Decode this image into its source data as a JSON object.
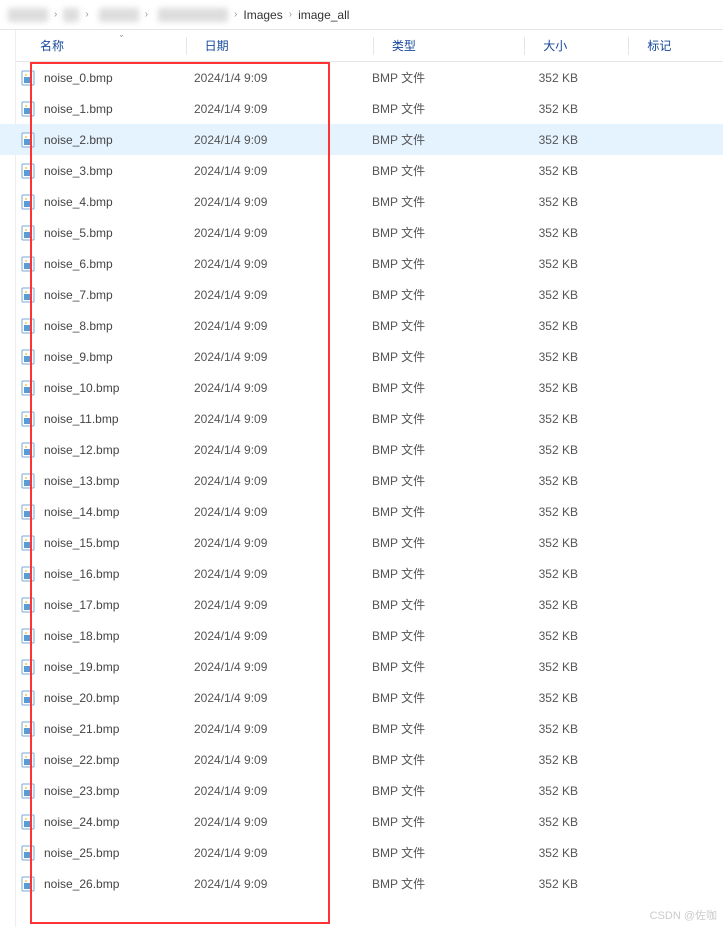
{
  "breadcrumb": {
    "sep": "›",
    "items": [
      "Images",
      "image_all"
    ]
  },
  "headers": {
    "name": "名称",
    "date": "日期",
    "type": "类型",
    "size": "大小",
    "tag": "标记",
    "sort_glyph": "ˇ"
  },
  "file_defaults": {
    "date": "2024/1/4 9:09",
    "type": "BMP 文件",
    "size": "352 KB"
  },
  "files": [
    {
      "name": "noise_0.bmp",
      "selected": false
    },
    {
      "name": "noise_1.bmp",
      "selected": false
    },
    {
      "name": "noise_2.bmp",
      "selected": true
    },
    {
      "name": "noise_3.bmp",
      "selected": false
    },
    {
      "name": "noise_4.bmp",
      "selected": false
    },
    {
      "name": "noise_5.bmp",
      "selected": false
    },
    {
      "name": "noise_6.bmp",
      "selected": false
    },
    {
      "name": "noise_7.bmp",
      "selected": false
    },
    {
      "name": "noise_8.bmp",
      "selected": false
    },
    {
      "name": "noise_9.bmp",
      "selected": false
    },
    {
      "name": "noise_10.bmp",
      "selected": false
    },
    {
      "name": "noise_11.bmp",
      "selected": false
    },
    {
      "name": "noise_12.bmp",
      "selected": false
    },
    {
      "name": "noise_13.bmp",
      "selected": false
    },
    {
      "name": "noise_14.bmp",
      "selected": false
    },
    {
      "name": "noise_15.bmp",
      "selected": false
    },
    {
      "name": "noise_16.bmp",
      "selected": false
    },
    {
      "name": "noise_17.bmp",
      "selected": false
    },
    {
      "name": "noise_18.bmp",
      "selected": false
    },
    {
      "name": "noise_19.bmp",
      "selected": false
    },
    {
      "name": "noise_20.bmp",
      "selected": false
    },
    {
      "name": "noise_21.bmp",
      "selected": false
    },
    {
      "name": "noise_22.bmp",
      "selected": false
    },
    {
      "name": "noise_23.bmp",
      "selected": false
    },
    {
      "name": "noise_24.bmp",
      "selected": false
    },
    {
      "name": "noise_25.bmp",
      "selected": false
    },
    {
      "name": "noise_26.bmp",
      "selected": false
    }
  ],
  "watermark": "CSDN @佐咖"
}
